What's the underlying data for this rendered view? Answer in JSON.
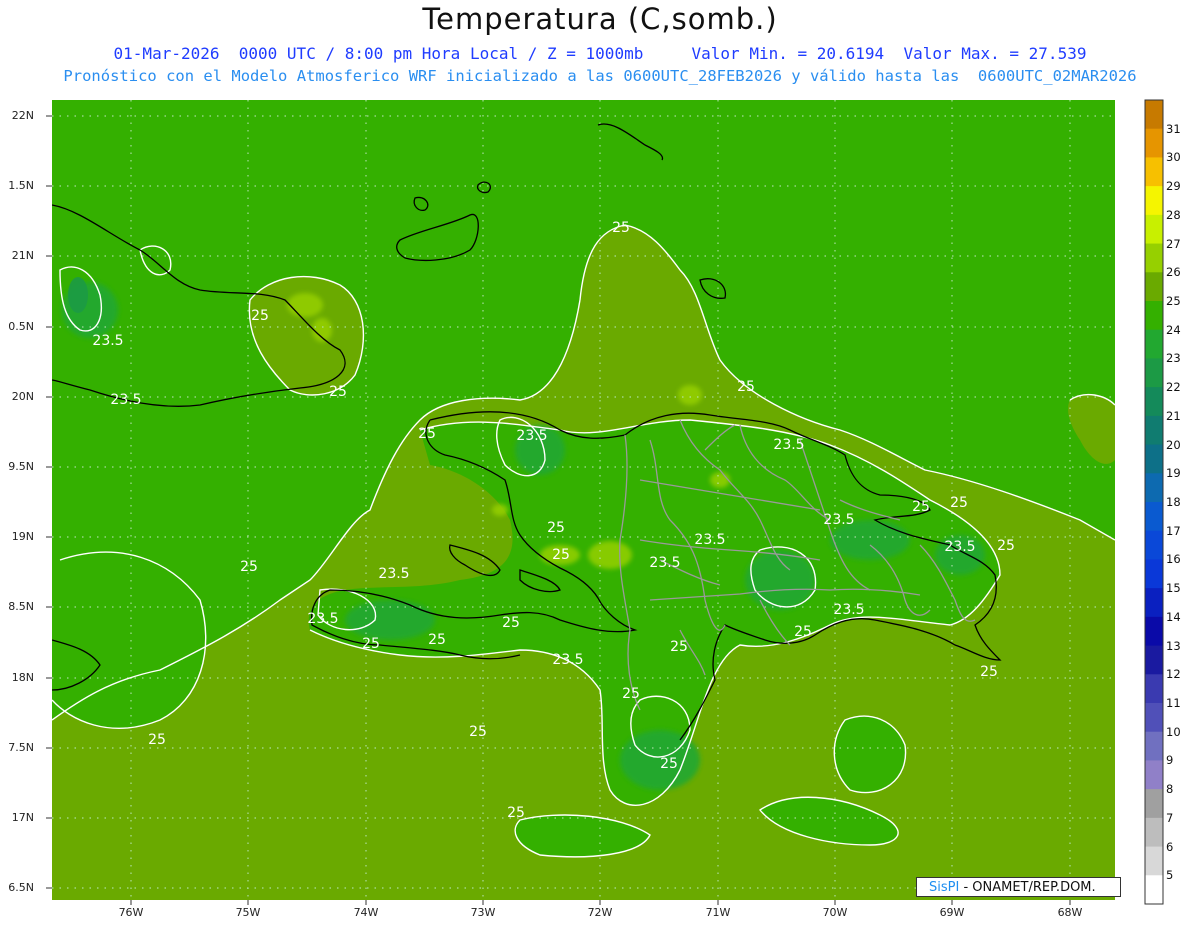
{
  "header": {
    "title": "Temperatura (C,somb.)",
    "line1_left": "01-Mar-2026  0000 UTC / 8:00 pm Hora Local / Z = 1000mb",
    "line1_right": "Valor Min. = 20.6194  Valor Max. = 27.539",
    "line2": "Pronóstico con el Modelo Atmosferico WRF inicializado a las 0600UTC_28FEB2026 y válido hasta las  0600UTC_02MAR2026"
  },
  "axes": {
    "lat_labels": [
      "22N",
      "1.5N",
      "21N",
      "0.5N",
      "20N",
      "9.5N",
      "19N",
      "8.5N",
      "18N",
      "7.5N",
      "17N",
      "6.5N"
    ],
    "lon_labels": [
      "76W",
      "75W",
      "74W",
      "73W",
      "72W",
      "71W",
      "70W",
      "69W",
      "68W"
    ]
  },
  "colorbar": {
    "labels": [
      "31",
      "30",
      "29",
      "28",
      "27",
      "26",
      "25",
      "24",
      "23",
      "22",
      "21",
      "20",
      "19",
      "18",
      "17",
      "16",
      "15",
      "14",
      "13",
      "12",
      "11",
      "10",
      "9",
      "8",
      "7",
      "6",
      "5"
    ],
    "colors": [
      "#c77a00",
      "#e69500",
      "#f7c000",
      "#f5f500",
      "#c8f000",
      "#96d000",
      "#6aaa00",
      "#34b000",
      "#22a830",
      "#1c9a45",
      "#148a5a",
      "#107c70",
      "#0d7088",
      "#0d6ab0",
      "#0a5ad0",
      "#0a48d8",
      "#0a38d8",
      "#0a20c0",
      "#0a0aa8",
      "#1a1aa0",
      "#3a3ab0",
      "#5050b8",
      "#7070c0",
      "#9080c8",
      "#a0a0a0",
      "#bdbdbd",
      "#d8d8d8",
      "#ffffff"
    ]
  },
  "contour_labels": [
    {
      "text": "25"
    },
    {
      "text": "23.5"
    },
    {
      "text": "25"
    },
    {
      "text": "23.5"
    },
    {
      "text": "25"
    },
    {
      "text": "25"
    },
    {
      "text": "23.5"
    },
    {
      "text": "25"
    },
    {
      "text": "23.5"
    },
    {
      "text": "23.5"
    },
    {
      "text": "25"
    },
    {
      "text": "25"
    },
    {
      "text": "23.5"
    },
    {
      "text": "23.5"
    },
    {
      "text": "25"
    },
    {
      "text": "25"
    },
    {
      "text": "25"
    },
    {
      "text": "23.5"
    },
    {
      "text": "23.5"
    },
    {
      "text": "25"
    },
    {
      "text": "23.5"
    },
    {
      "text": "25"
    },
    {
      "text": "25"
    },
    {
      "text": "23.5"
    },
    {
      "text": "25"
    },
    {
      "text": "25"
    },
    {
      "text": "23.5"
    },
    {
      "text": "25"
    },
    {
      "text": "25"
    },
    {
      "text": "25"
    },
    {
      "text": "25"
    },
    {
      "text": "25"
    },
    {
      "text": "25"
    },
    {
      "text": "25"
    }
  ],
  "credit": {
    "brand": "SisPI",
    "suffix": " - ONAMET/REP.DOM."
  }
}
